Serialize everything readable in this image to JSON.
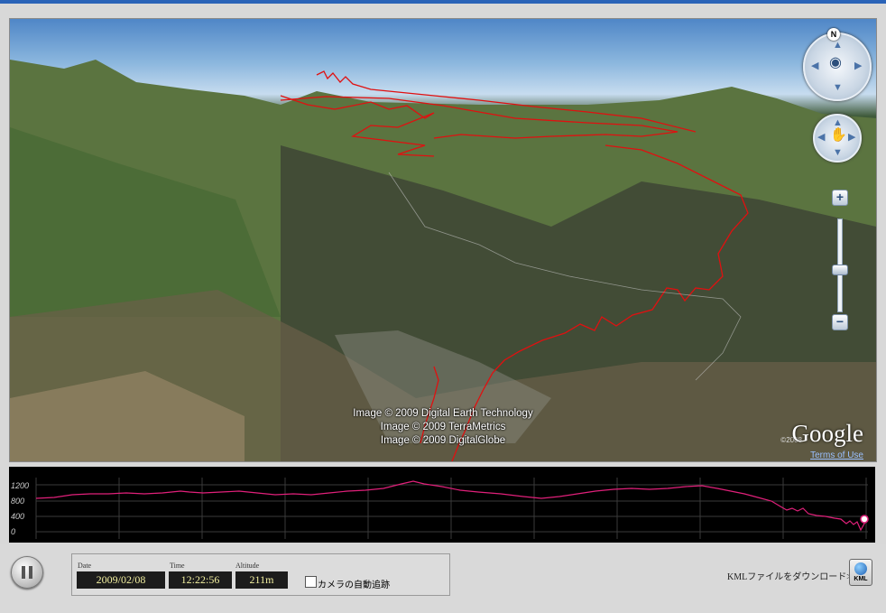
{
  "viewport": {
    "credits": [
      "Image © 2009 Digital Earth Technology",
      "Image © 2009 TerraMetrics",
      "Image © 2009 DigitalGlobe"
    ],
    "logo_text": "Google",
    "logo_year": "©2008",
    "terms_label": "Terms of Use",
    "compass_label": "N"
  },
  "zoom": {
    "in_label": "+",
    "out_label": "−",
    "level": 0.68
  },
  "elevation_profile": {
    "y_ticks": [
      "1200",
      "800",
      "400",
      "0"
    ],
    "line_color": "#e0207a"
  },
  "player": {
    "date_label": "Date",
    "date_value": "2009/02/08",
    "time_label": "Time",
    "time_value": "12:22:56",
    "altitude_label": "Altitude",
    "altitude_value": "211m",
    "camera_follow_label": "カメラの自動追跡",
    "camera_follow_checked": false,
    "kml_link_label": "KMLファイルをダウンロード>>",
    "kml_icon_label": "KML"
  },
  "colors": {
    "track": "#e01010",
    "accent": "#2a63b8"
  }
}
